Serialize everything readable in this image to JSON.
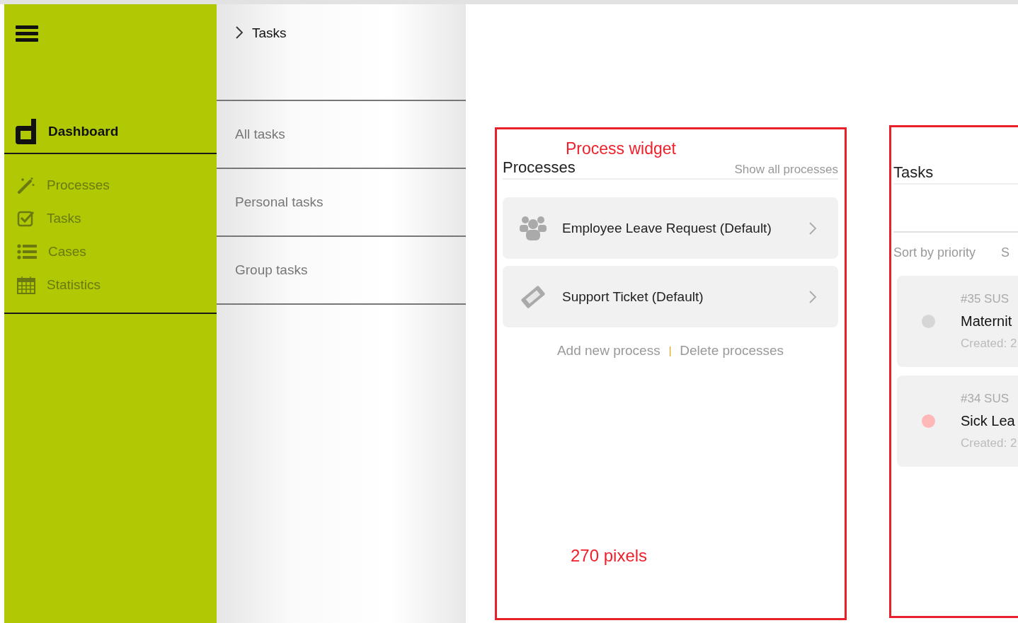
{
  "sidebar": {
    "title": "Dashboard",
    "items": [
      {
        "kind": "wand",
        "label": "Processes"
      },
      {
        "kind": "check",
        "label": "Tasks"
      },
      {
        "kind": "list",
        "label": "Cases"
      },
      {
        "kind": "calendar",
        "label": "Statistics"
      }
    ]
  },
  "submenu": {
    "back": "Tasks",
    "items": [
      "All tasks",
      "Personal tasks",
      "Group tasks"
    ]
  },
  "process_widget": {
    "annotation": "Process widget",
    "title": "Processes",
    "show_all": "Show all processes",
    "processes": [
      {
        "kind": "people",
        "name": "Employee Leave Request (Default)"
      },
      {
        "kind": "ticket",
        "name": "Support Ticket (Default)"
      }
    ],
    "add": "Add new process",
    "separator": "|",
    "delete": "Delete processes",
    "size_note": "270 pixels"
  },
  "task_widget": {
    "title": "Tasks",
    "sorts": [
      "Sort by priority",
      "S"
    ],
    "tasks": [
      {
        "id": "#35 SUS",
        "name": "Maternit",
        "created": "Created: 2",
        "color": "#d6d6d6"
      },
      {
        "id": "#34 SUS",
        "name": "Sick Lea",
        "created": "Created: 2",
        "color": "#ffb8b8"
      }
    ]
  }
}
